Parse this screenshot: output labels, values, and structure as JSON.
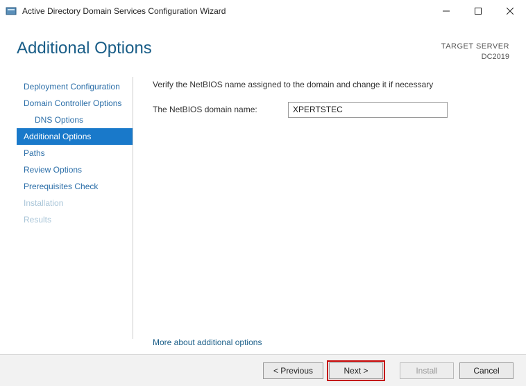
{
  "titlebar": {
    "title": "Active Directory Domain Services Configuration Wizard"
  },
  "header": {
    "page_title": "Additional Options",
    "target_label": "TARGET SERVER",
    "target_value": "DC2019"
  },
  "sidebar": {
    "items": [
      {
        "label": "Deployment Configuration",
        "selected": false,
        "indent": false,
        "disabled": false
      },
      {
        "label": "Domain Controller Options",
        "selected": false,
        "indent": false,
        "disabled": false
      },
      {
        "label": "DNS Options",
        "selected": false,
        "indent": true,
        "disabled": false
      },
      {
        "label": "Additional Options",
        "selected": true,
        "indent": false,
        "disabled": false
      },
      {
        "label": "Paths",
        "selected": false,
        "indent": false,
        "disabled": false
      },
      {
        "label": "Review Options",
        "selected": false,
        "indent": false,
        "disabled": false
      },
      {
        "label": "Prerequisites Check",
        "selected": false,
        "indent": false,
        "disabled": false
      },
      {
        "label": "Installation",
        "selected": false,
        "indent": false,
        "disabled": true
      },
      {
        "label": "Results",
        "selected": false,
        "indent": false,
        "disabled": true
      }
    ]
  },
  "main": {
    "instruction": "Verify the NetBIOS name assigned to the domain and change it if necessary",
    "field_label": "The NetBIOS domain name:",
    "field_value": "XPERTSTEC",
    "more_link": "More about additional options"
  },
  "footer": {
    "previous": "< Previous",
    "next": "Next >",
    "install": "Install",
    "cancel": "Cancel"
  }
}
